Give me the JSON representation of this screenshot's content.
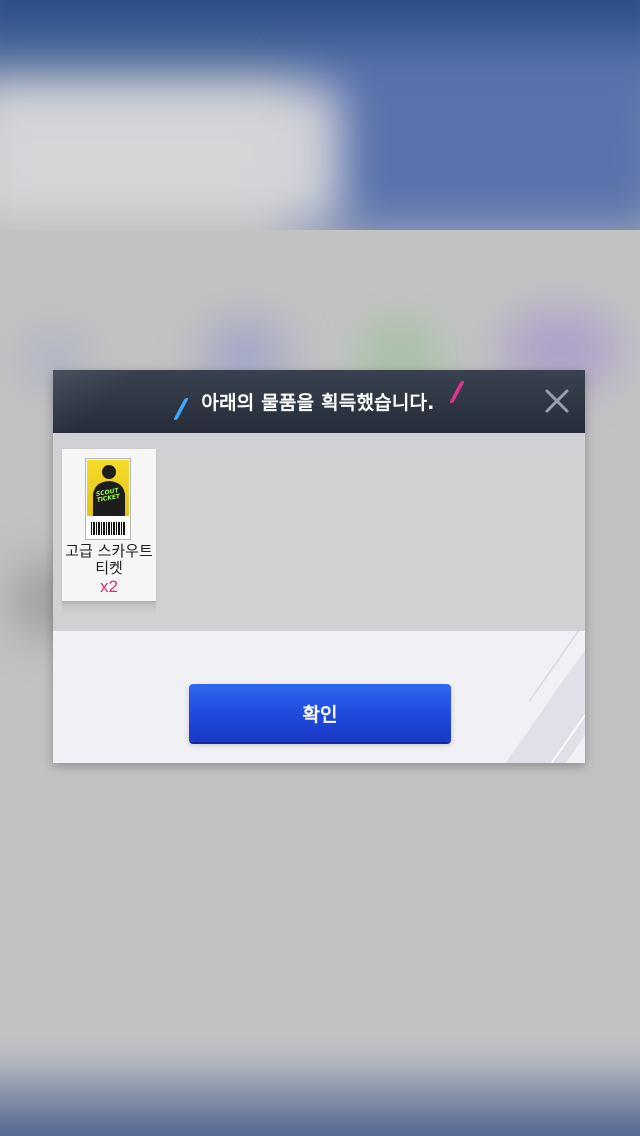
{
  "dialog": {
    "title": "아래의 물품을 획득했습니다.",
    "close_icon": "close-icon",
    "items": [
      {
        "name": "고급 스카우트 티켓",
        "quantity": "x2",
        "icon": "scout-ticket-icon",
        "ticket_text": "SCOUT TICKET"
      }
    ],
    "confirm_label": "확인"
  },
  "colors": {
    "header_bg": "#2b313e",
    "confirm_button": "#2451e4",
    "quantity_text": "#e3287e",
    "slash_left": "#3fa7ff",
    "slash_right": "#e0338a"
  }
}
